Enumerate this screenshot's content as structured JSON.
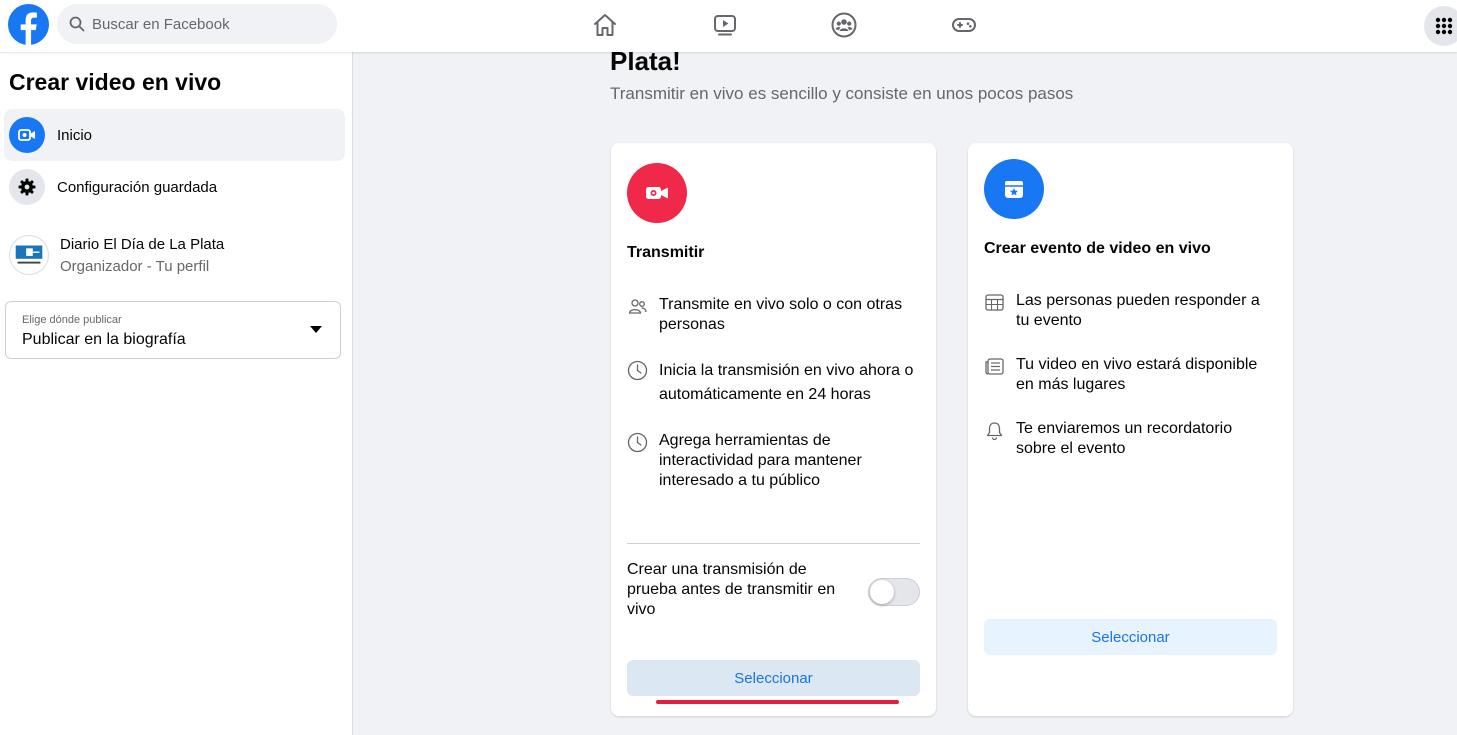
{
  "topbar": {
    "logo_icon": "facebook-logo-icon",
    "search_placeholder": "Buscar en Facebook",
    "nav_icons": [
      "home-icon",
      "watch-icon",
      "groups-icon",
      "gaming-icon"
    ],
    "menu_icon": "grid-menu-icon"
  },
  "sidebar": {
    "title": "Crear video en vivo",
    "items": [
      {
        "label": "Inicio",
        "icon": "video-camera-icon"
      },
      {
        "label": "Configuración guardada",
        "icon": "gear-icon"
      }
    ],
    "profile": {
      "name": "Diario El Día de La Plata",
      "role": "Organizador - Tu perfil"
    },
    "publish_select": {
      "label": "Elige dónde publicar",
      "value": "Publicar en la biografía"
    }
  },
  "main": {
    "heading": "Plata!",
    "subheading": "Transmitir en vivo es sencillo y consiste en unos pocos pasos",
    "cards": [
      {
        "title": "Transmitir",
        "icon": "live-video-icon",
        "icon_color": "#f02849",
        "features": [
          {
            "icon": "people-icon",
            "text": "Transmite en vivo solo o con otras personas"
          },
          {
            "icon": "clock-icon",
            "text": "Inicia la transmisión en vivo ahora o automáticamente en 24 horas"
          },
          {
            "icon": "clock-icon",
            "text": "Agrega herramientas de interactividad para mantener interesado a tu público"
          }
        ],
        "test_label": "Crear una transmisión de prueba antes de transmitir en vivo",
        "test_toggle_on": false,
        "button": "Seleccionar"
      },
      {
        "title": "Crear evento de video en vivo",
        "icon": "calendar-star-icon",
        "icon_color": "#1877f2",
        "features": [
          {
            "icon": "calendar-grid-icon",
            "text": "Las personas pueden responder a tu evento"
          },
          {
            "icon": "newsfeed-icon",
            "text": "Tu video en vivo estará disponible en más lugares"
          },
          {
            "icon": "bell-icon",
            "text": "Te enviaremos un recordatorio sobre el evento"
          }
        ],
        "button": "Seleccionar"
      }
    ],
    "accent": "#1b74e4",
    "highlight_color": "#e41e3f"
  }
}
